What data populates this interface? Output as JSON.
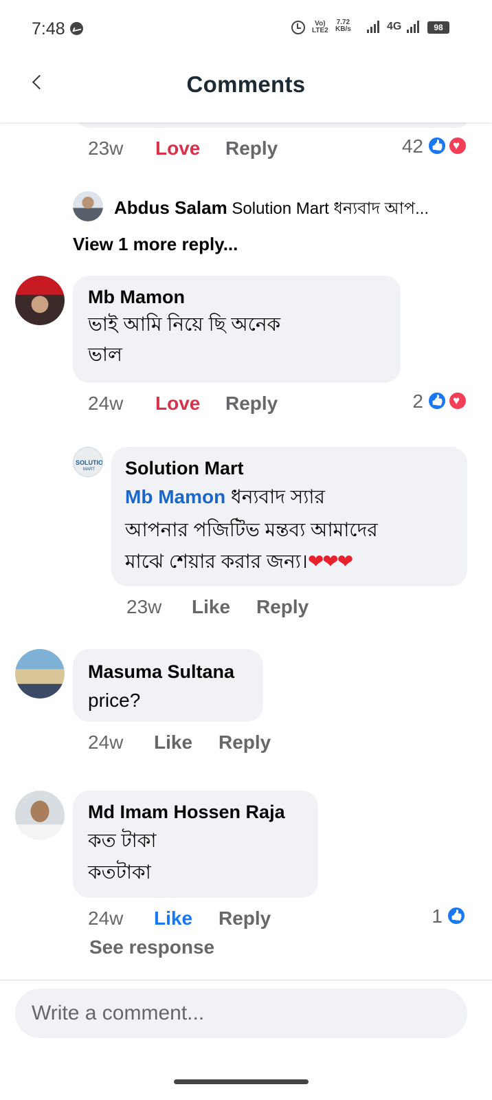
{
  "status_bar": {
    "time": "7:48",
    "volte": "Vo)",
    "lte": "LTE2",
    "speed_value": "7.72",
    "speed_unit": "KB/s",
    "network": "4G",
    "battery": "98",
    "icons": [
      "messenger-icon",
      "alarm-icon",
      "signal-icon",
      "battery-icon"
    ]
  },
  "header": {
    "title": "Comments",
    "back_icon": "chevron-left-icon"
  },
  "previous_comment": {
    "time": "23w",
    "reaction_label": "Love",
    "reply_label": "Reply",
    "reaction_count": "42"
  },
  "reply_preview": {
    "author": "Abdus Salam",
    "text": "Solution Mart ধন্যবাদ আপ...",
    "view_more": "View 1 more reply..."
  },
  "comments": [
    {
      "author": "Mb Mamon",
      "lines": [
        "ভাই আমি  নিয়ে  ছি অনেক",
        "ভাল"
      ],
      "time": "24w",
      "reaction_label": "Love",
      "reply_label": "Reply",
      "reaction_count": "2"
    },
    {
      "author": "Solution Mart",
      "mention": "Mb Mamon",
      "lines": [
        " ধন্যবাদ স্যার",
        "আপনার পজিটিভ মন্তব্য আমাদের",
        "মাঝে শেয়ার করার জন্য।"
      ],
      "hearts": "❤❤❤",
      "time": "23w",
      "reaction_label": "Like",
      "reply_label": "Reply"
    },
    {
      "author": "Masuma Sultana",
      "lines": [
        "price?"
      ],
      "time": "24w",
      "reaction_label": "Like",
      "reply_label": "Reply"
    },
    {
      "author": "Md Imam Hossen Raja",
      "lines": [
        "কত টাকা",
        "কতটাকা"
      ],
      "time": "24w",
      "reaction_label": "Like",
      "reply_label": "Reply",
      "reaction_count": "1",
      "see_response": "See response"
    }
  ],
  "composer": {
    "placeholder": "Write a comment..."
  },
  "colors": {
    "love": "#d8324b",
    "like_active": "#1877f2",
    "mention": "#1b66c9",
    "bubble": "#f0f2f5",
    "meta": "#65676b"
  }
}
